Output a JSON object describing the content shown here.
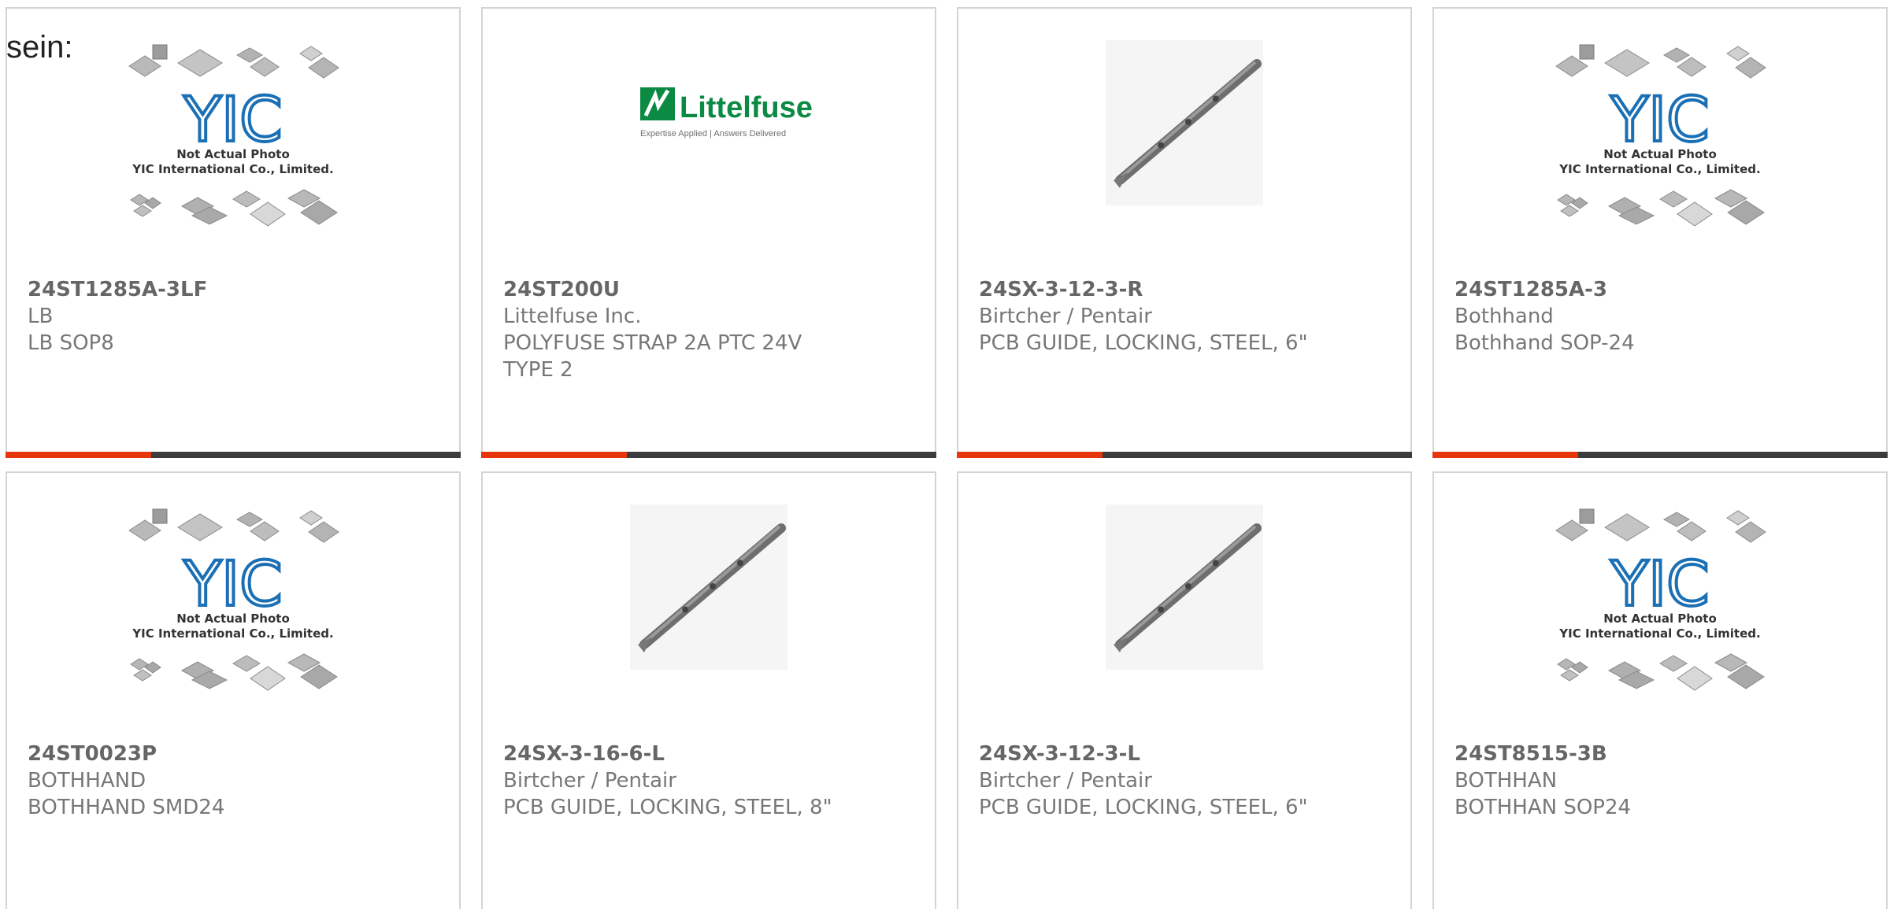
{
  "intro_text": "sein:",
  "colors": {
    "accent": "#e8360c",
    "track": "#3c3c3c",
    "yic_blue": "#1a6fb5",
    "littelfuse_green": "#0b8a43"
  },
  "yic_placeholder": {
    "logo": "YIC",
    "line1": "Not Actual Photo",
    "line2": "YIC International Co., Limited."
  },
  "littelfuse_logo": {
    "name": "Littelfuse",
    "tagline": "Expertise Applied | Answers Delivered"
  },
  "products": [
    {
      "part_number": "24ST1285A-3LF",
      "manufacturer": "LB",
      "description": "LB SOP8",
      "image": "yic-placeholder",
      "progress": 0.32
    },
    {
      "part_number": "24ST200U",
      "manufacturer": "Littelfuse Inc.",
      "description": "POLYFUSE STRAP 2A PTC 24V TYPE 2",
      "image": "littelfuse-logo",
      "progress": 0.32
    },
    {
      "part_number": "24SX-3-12-3-R",
      "manufacturer": "Birtcher / Pentair",
      "description": "PCB GUIDE, LOCKING, STEEL, 6\"",
      "image": "pcb-guide-rail",
      "progress": 0.32
    },
    {
      "part_number": "24ST1285A-3",
      "manufacturer": "Bothhand",
      "description": "Bothhand SOP-24",
      "image": "yic-placeholder",
      "progress": 0.32
    },
    {
      "part_number": "24ST0023P",
      "manufacturer": "BOTHHAND",
      "description": "BOTHHAND SMD24",
      "image": "yic-placeholder"
    },
    {
      "part_number": "24SX-3-16-6-L",
      "manufacturer": "Birtcher / Pentair",
      "description": "PCB GUIDE, LOCKING, STEEL, 8\"",
      "image": "pcb-guide-rail"
    },
    {
      "part_number": "24SX-3-12-3-L",
      "manufacturer": "Birtcher / Pentair",
      "description": "PCB GUIDE, LOCKING, STEEL, 6\"",
      "image": "pcb-guide-rail"
    },
    {
      "part_number": "24ST8515-3B",
      "manufacturer": "BOTHHAN",
      "description": "BOTHHAN SOP24",
      "image": "yic-placeholder"
    }
  ]
}
